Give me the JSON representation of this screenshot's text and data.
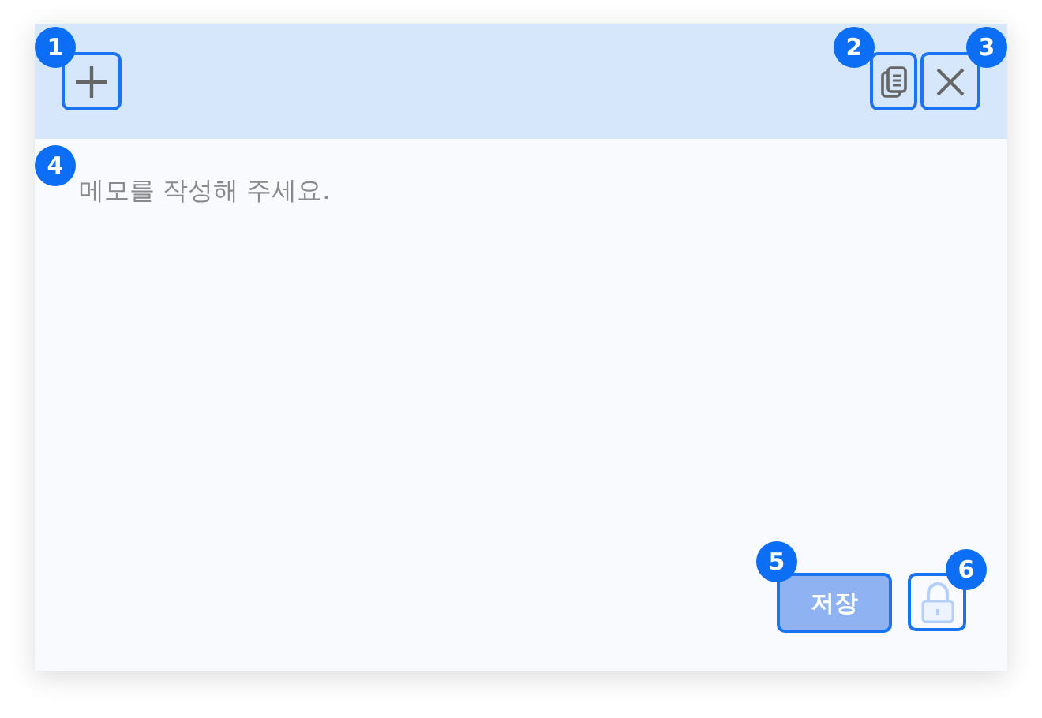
{
  "header": {
    "left_buttons": [
      {
        "kind": "add",
        "badge": "1"
      }
    ],
    "right_buttons": [
      {
        "kind": "copy",
        "badge": "2"
      },
      {
        "kind": "close",
        "badge": "3"
      }
    ]
  },
  "memo": {
    "placeholder": "메모를 작성해 주세요.",
    "badge": "4"
  },
  "footer": {
    "save": {
      "label": "저장",
      "disabled": true,
      "badge": "5"
    },
    "lock": {
      "locked": true,
      "badge": "6"
    }
  }
}
